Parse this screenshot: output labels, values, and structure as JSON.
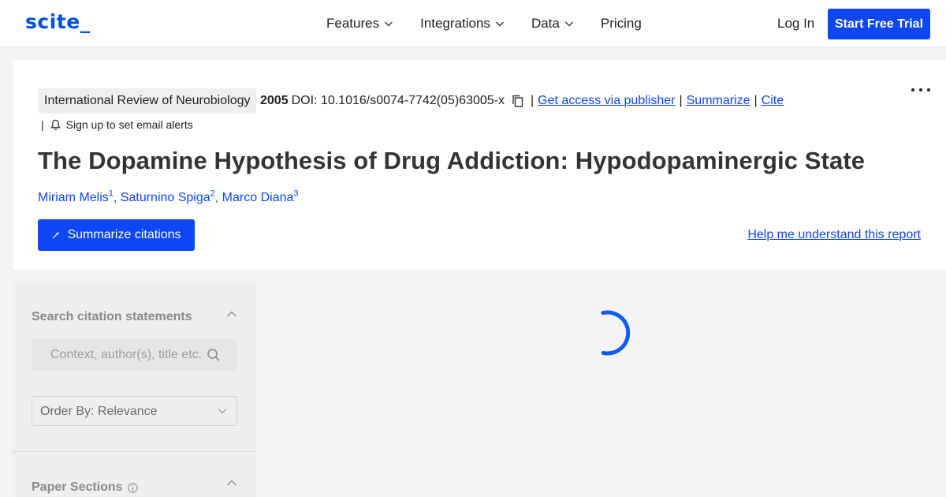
{
  "brand": {
    "logo": "scite_",
    "accent": "#0d47f5"
  },
  "nav": {
    "items": [
      {
        "label": "Features",
        "has_dropdown": true
      },
      {
        "label": "Integrations",
        "has_dropdown": true
      },
      {
        "label": "Data",
        "has_dropdown": true
      },
      {
        "label": "Pricing",
        "has_dropdown": false
      }
    ],
    "login": "Log In",
    "trial": "Start Free Trial"
  },
  "paper": {
    "journal": "International Review of Neurobiology",
    "year": "2005",
    "doi": "DOI: 10.1016/s0074-7742(05)63005-x",
    "links": {
      "access": "Get access via publisher",
      "summarize": "Summarize",
      "cite": "Cite"
    },
    "alerts": "Sign up to set email alerts",
    "title": "The Dopamine Hypothesis of Drug Addiction: Hypodopaminergic State",
    "authors": [
      {
        "name": "Miriam Melis",
        "sup": "1"
      },
      {
        "name": "Saturnino Spiga",
        "sup": "2"
      },
      {
        "name": "Marco Diana",
        "sup": "3"
      }
    ],
    "summarize_button": "Summarize citations",
    "help_link": "Help me understand this report"
  },
  "sidebar": {
    "search_heading": "Search citation statements",
    "search_placeholder": "Context, author(s), title etc.",
    "order_by": "Order By: Relevance",
    "sections_heading": "Paper Sections"
  },
  "icons": {
    "copy": "copy-icon",
    "bell": "bell-icon",
    "more": "more-icon",
    "spark": "sparkle-icon",
    "search": "search-icon",
    "chevron": "chevron-down-icon",
    "caret_up": "chevron-up-icon",
    "info": "info-icon",
    "spinner": "loading-spinner"
  }
}
